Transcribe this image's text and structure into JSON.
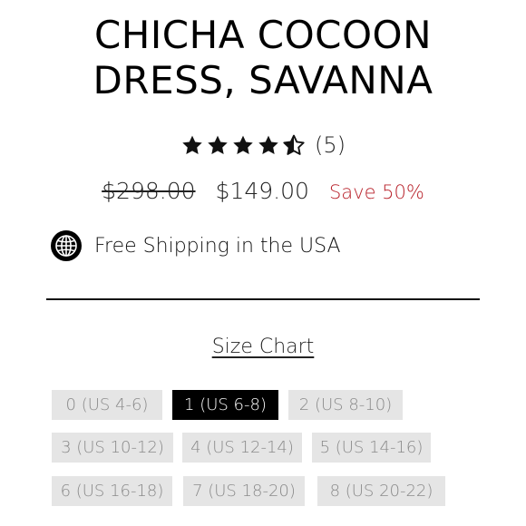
{
  "product": {
    "title_line1": "CHICHA COCOON",
    "title_line2": "DRESS, SAVANNA",
    "rating": 4.5,
    "stars_filled": 4,
    "stars_half": 1,
    "stars_total": 5,
    "review_count": "(5)"
  },
  "pricing": {
    "original_price": "$298.00",
    "sale_price": "$149.00",
    "save_label": "Save 50%"
  },
  "shipping": {
    "icon": "globe-icon",
    "text": "Free Shipping in the USA"
  },
  "size_chart": {
    "label": "Size Chart"
  },
  "sizes": {
    "selected": "1 (US 6-8)",
    "options": [
      "0 (US 4-6)",
      "1 (US 6-8)",
      "2 (US 8-10)",
      "3 (US 10-12)",
      "4 (US 12-14)",
      "5 (US 14-16)",
      "6 (US 16-18)",
      "7 (US 18-20)",
      "8 (US 20-22)"
    ]
  },
  "colors": {
    "text": "#111111",
    "save": "#b8222b",
    "size_bg": "#e5e5e5",
    "size_text": "#8a8a8a",
    "selected_bg": "#000000",
    "selected_text": "#ffffff"
  }
}
